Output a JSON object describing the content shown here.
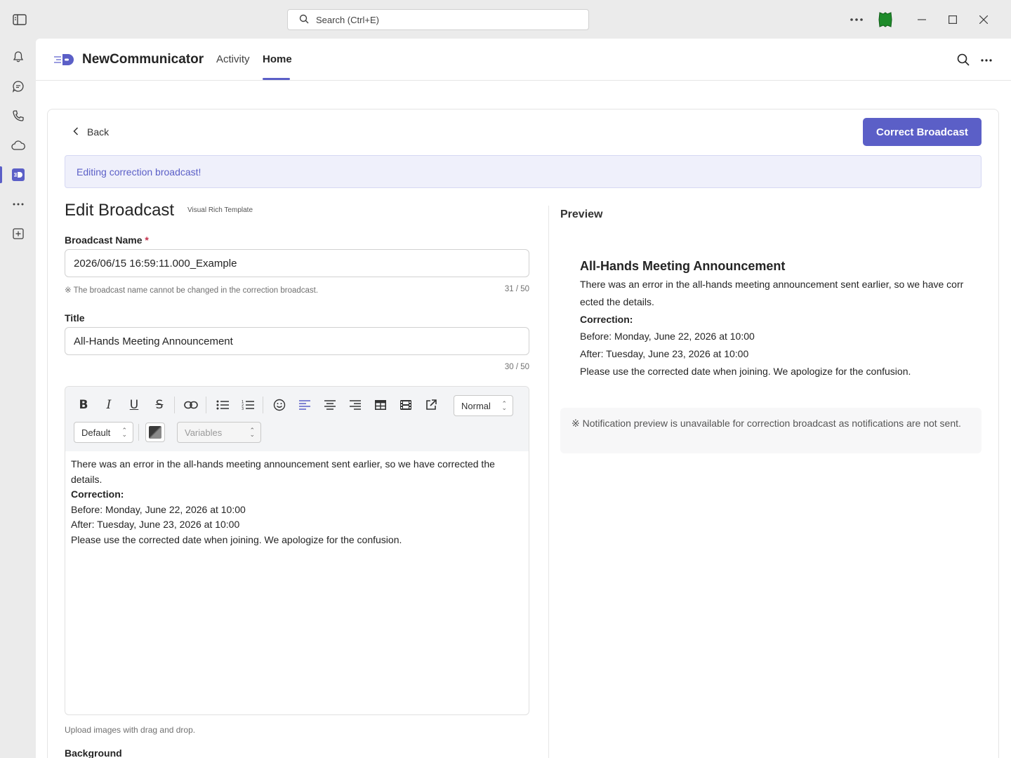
{
  "window": {
    "search_placeholder": "Search (Ctrl+E)"
  },
  "rail": {
    "items": [
      "notifications-icon",
      "chat-icon",
      "calls-icon",
      "cloud-icon",
      "newcommunicator-app-icon",
      "more-apps-icon",
      "add-app-icon"
    ]
  },
  "appbar": {
    "app_name": "NewCommunicator",
    "tabs": [
      {
        "label": "Activity"
      },
      {
        "label": "Home"
      }
    ],
    "active_tab": "Home"
  },
  "page": {
    "back_label": "Back",
    "primary_button": "Correct Broadcast",
    "notice": "Editing correction broadcast!",
    "heading": "Edit Broadcast",
    "template_badge": "Visual Rich Template",
    "broadcast_name": {
      "label": "Broadcast Name",
      "required_mark": "*",
      "value": "2026/06/15 16:59:11.000_Example",
      "hint": "※ The broadcast name cannot be changed in the correction broadcast.",
      "count": "31 / 50"
    },
    "title_field": {
      "label": "Title",
      "value": "All-Hands Meeting Announcement",
      "count": "30 / 50"
    },
    "editor": {
      "block_format": "Normal",
      "font_select": "Default",
      "variables_placeholder": "Variables",
      "body": {
        "line1": "There was an error in the all-hands meeting announcement sent earlier, so we have corrected the details.",
        "line2": "Correction:",
        "line3": "Before: Monday, June 22, 2026 at 10:00",
        "line4": "After: Tuesday, June 23, 2026 at 10:00",
        "line5": "Please use the corrected date when joining. We apologize for the confusion."
      }
    },
    "upload_hint": "Upload images with drag and drop.",
    "next_section_label": "Background"
  },
  "preview": {
    "label": "Preview",
    "title": "All-Hands Meeting Announcement",
    "line1": "There was an error in the all-hands meeting announcement sent earlier, so we have corrected the details.",
    "line2": "Correction:",
    "line3": "Before: Monday, June 22, 2026 at 10:00",
    "line4": "After: Tuesday, June 23, 2026 at 10:00",
    "line5": "Please use the corrected date when joining. We apologize for the confusion.",
    "note": "※ Notification preview is unavailable for correction broadcast as notifications are not sent."
  },
  "colors": {
    "accent": "#5b5fc7",
    "notice_bg": "#eff0fb",
    "avatar": "#1e8b2a"
  }
}
